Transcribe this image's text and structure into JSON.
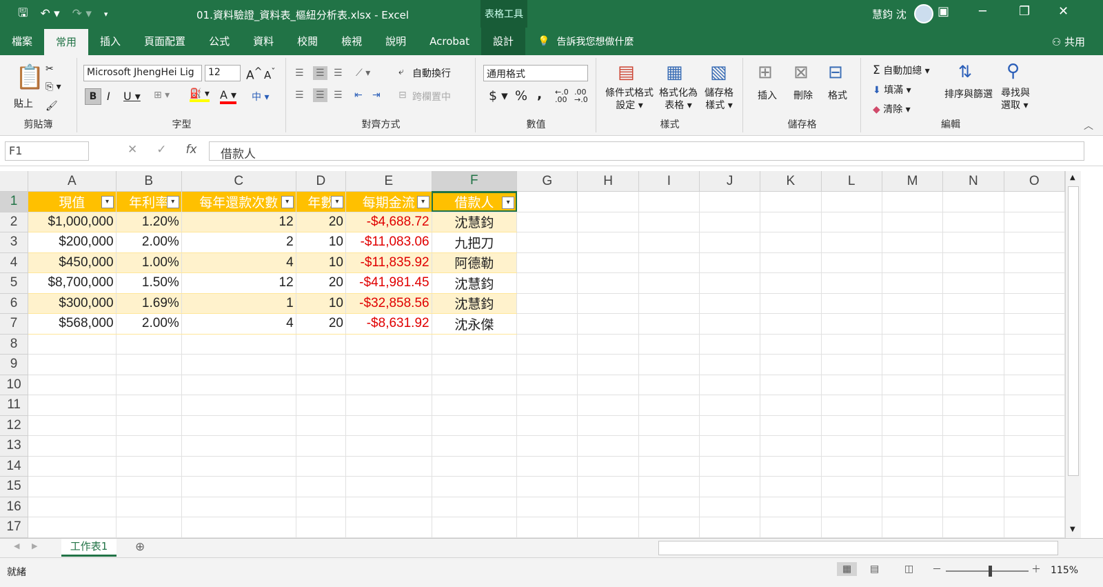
{
  "titlebar": {
    "title": "01.資料驗證_資料表_樞紐分析表.xlsx  -  Excel",
    "context": "表格工具",
    "user": "慧鈞 沈"
  },
  "tabs": [
    "檔案",
    "常用",
    "插入",
    "頁面配置",
    "公式",
    "資料",
    "校閱",
    "檢視",
    "說明",
    "Acrobat",
    "設計"
  ],
  "tell": "告訴我您想做什麼",
  "share": "共用",
  "ribbon": {
    "clipboard": {
      "paste": "貼上",
      "label": "剪貼簿"
    },
    "font": {
      "name": "Microsoft JhengHei Lig",
      "size": "12",
      "label": "字型"
    },
    "align": {
      "wrap": "自動換行",
      "merge": "跨欄置中",
      "label": "對齊方式"
    },
    "number": {
      "format": "通用格式",
      "label": "數值"
    },
    "styles": {
      "cond": "條件式格式",
      "cond2": "設定",
      "astable": "格式化為",
      "astable2": "表格",
      "cellstyle": "儲存格",
      "cellstyle2": "樣式",
      "label": "樣式"
    },
    "cells": {
      "insert": "插入",
      "delete": "刪除",
      "format": "格式",
      "label": "儲存格"
    },
    "editing": {
      "autosum": "自動加總",
      "fill": "填滿",
      "clear": "清除",
      "sort": "排序與篩選",
      "find": "尋找與",
      "find2": "選取",
      "label": "編輯"
    }
  },
  "namebox": "F1",
  "formula": "借款人",
  "columns": [
    "A",
    "B",
    "C",
    "D",
    "E",
    "F",
    "G",
    "H",
    "I",
    "J",
    "K",
    "L",
    "M",
    "N",
    "O"
  ],
  "headers": [
    "現值",
    "年利率",
    "每年還款次數",
    "年數",
    "每期金流",
    "借款人"
  ],
  "rows": [
    [
      "$1,000,000",
      "1.20%",
      "12",
      "20",
      "-$4,688.72",
      "沈慧鈞"
    ],
    [
      "$200,000",
      "2.00%",
      "2",
      "10",
      "-$11,083.06",
      "九把刀"
    ],
    [
      "$450,000",
      "1.00%",
      "4",
      "10",
      "-$11,835.92",
      "阿德勒"
    ],
    [
      "$8,700,000",
      "1.50%",
      "12",
      "20",
      "-$41,981.45",
      "沈慧鈞"
    ],
    [
      "$300,000",
      "1.69%",
      "1",
      "10",
      "-$32,858.56",
      "沈慧鈞"
    ],
    [
      "$568,000",
      "2.00%",
      "4",
      "20",
      "-$8,631.92",
      "沈永傑"
    ]
  ],
  "rownums": [
    "1",
    "2",
    "3",
    "4",
    "5",
    "6",
    "7",
    "8",
    "9",
    "10",
    "11",
    "12",
    "13",
    "14",
    "15",
    "16",
    "17"
  ],
  "sheet": "工作表1",
  "status": "就緒",
  "zoom": "115%"
}
